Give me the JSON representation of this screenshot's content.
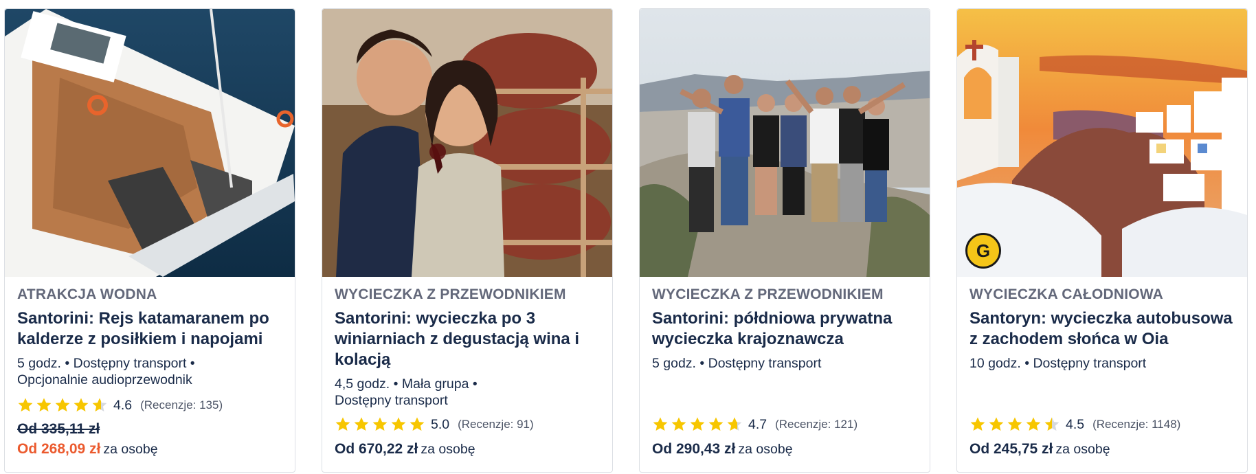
{
  "cards": [
    {
      "category": "ATRAKCJA WODNA",
      "title": "Santorini: Rejs katamaranem po kalderze z posiłkiem i napojami",
      "meta_line1": "5 godz. • Dostępny transport •",
      "meta_line2": "Opcjonalnie audioprzewodnik",
      "rating": 4.6,
      "rating_text": "4.6",
      "reviews": "(Recenzje: 135)",
      "old_price": "Od 335,11 zł",
      "price": "Od 268,09 zł",
      "unit": "za osobę",
      "image_icon": "catamaran-photo"
    },
    {
      "category": "WYCIECZKA Z PRZEWODNIKIEM",
      "title": "Santorini: wycieczka po 3 winiarniach z degustacją wina i kolacją",
      "meta_line1": "4,5 godz. • Mała grupa •",
      "meta_line2": "Dostępny transport",
      "rating": 5.0,
      "rating_text": "5.0",
      "reviews": "(Recenzje: 91)",
      "price": "Od 670,22 zł",
      "unit": "za osobę",
      "image_icon": "wine-tasting-photo"
    },
    {
      "category": "WYCIECZKA Z PRZEWODNIKIEM",
      "title": "Santorini: półdniowa prywatna wycieczka krajoznawcza",
      "meta_line1": "5 godz. • Dostępny transport",
      "rating": 4.7,
      "rating_text": "4.7",
      "reviews": "(Recenzje: 121)",
      "price": "Od 290,43 zł",
      "unit": "za osobę",
      "image_icon": "group-photo"
    },
    {
      "category": "WYCIECZKA CAŁODNIOWA",
      "title": "Santoryn: wycieczka autobusowa z zachodem słońca w Oia",
      "meta_line1": "10 godz. • Dostępny transport",
      "rating": 4.5,
      "rating_text": "4.5",
      "reviews": "(Recenzje: 1148)",
      "price": "Od 245,75 zł",
      "unit": "za osobę",
      "badge_icon": "getyourguide-originals-icon",
      "image_icon": "oia-sunset-photo"
    }
  ],
  "colors": {
    "title": "#1a2b49",
    "category": "#63687a",
    "sale": "#eb5a2e",
    "star": "#f7c600",
    "border": "#dcdfe4"
  }
}
